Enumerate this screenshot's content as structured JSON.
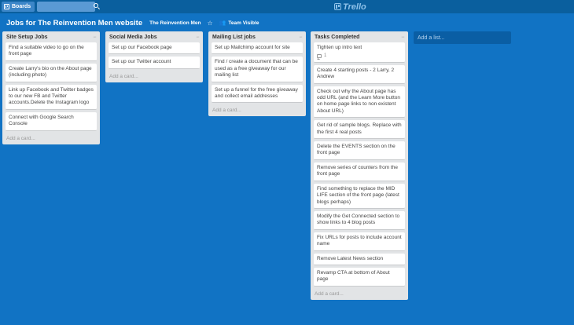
{
  "topbar": {
    "boards_label": "Boards",
    "search_value": "",
    "logo_text": "Trello"
  },
  "board": {
    "title": "Jobs for The Reinvention Men website",
    "org": "The Reinvention Men",
    "star_icon": "star-icon",
    "visibility": "Team Visible"
  },
  "lists": [
    {
      "title": "Site Setup Jobs",
      "cards": [
        {
          "text": "Find a suitable video to go on the front page"
        },
        {
          "text": "Create Larry's bio on the About page (including photo)"
        },
        {
          "text": "Link up Facebook and Twitter badges to our new FB and Twitter accounts.Delete the Instagram logo"
        },
        {
          "text": "Connect with Google Search Console"
        }
      ],
      "add_card": "Add a card..."
    },
    {
      "title": "Social Media Jobs",
      "cards": [
        {
          "text": "Set up our Facebook page"
        },
        {
          "text": "Set up our Twitter account"
        }
      ],
      "add_card": "Add a card..."
    },
    {
      "title": "Mailing List jobs",
      "cards": [
        {
          "text": "Set up Mailchimp account for site"
        },
        {
          "text": "Find / create a document that can be used as a free giveaway for our mailing list"
        },
        {
          "text": "Set up a funnel for the free giveaway and collect email addresses"
        }
      ],
      "add_card": "Add a card..."
    },
    {
      "title": "Tasks Completed",
      "cards": [
        {
          "text": "Tighten up intro text",
          "comments": "1"
        },
        {
          "text": "Create 4 starting posts - 2 Larry, 2 Andrew"
        },
        {
          "text": "Check out why the About page has odd URL (and the Learn More button on home page links to non existent About URL)"
        },
        {
          "text": "Get rid of sample blogs. Replace with the first 4 real posts"
        },
        {
          "text": "Delete the EVENTS section on the front page"
        },
        {
          "text": "Remove series of counters from the front page"
        },
        {
          "text": "Find something to replace the MID LIFE section of the front page (latest blogs perhaps)"
        },
        {
          "text": "Modify the Get Connected section to show links to 4 blog posts"
        },
        {
          "text": "Fix URLs for posts to include account name"
        },
        {
          "text": "Remove Latest News section"
        },
        {
          "text": "Revamp CTA at bottom of About page"
        }
      ],
      "add_card": "Add a card..."
    }
  ],
  "add_list": "Add a list..."
}
